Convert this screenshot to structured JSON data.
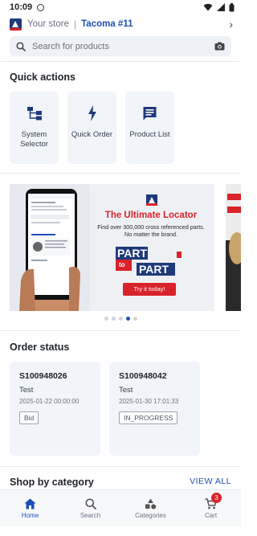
{
  "status_bar": {
    "time": "10:09"
  },
  "store": {
    "label": "Your store",
    "name": "Tacoma #11"
  },
  "search": {
    "placeholder": "Search for products"
  },
  "quick_actions": {
    "title": "Quick actions",
    "items": [
      {
        "label": "System Selector",
        "icon": "hierarchy-icon"
      },
      {
        "label": "Quick Order",
        "icon": "lightning-icon"
      },
      {
        "label": "Product List",
        "icon": "list-chat-icon"
      }
    ]
  },
  "banner": {
    "title": "The Ultimate Locator",
    "subtitle": "Find over 300,000 cross referenced parts. No matter the brand.",
    "logo_text_top": "PART",
    "logo_text_mid": "to",
    "logo_text_bottom": "PART",
    "button": "Try it today!",
    "pager": {
      "count": 5,
      "active": 3
    }
  },
  "order_status": {
    "title": "Order status",
    "orders": [
      {
        "id": "S100948026",
        "name": "Test",
        "date": "2025-01-22 00:00:00",
        "status": "Bid"
      },
      {
        "id": "S100948042",
        "name": "Test",
        "date": "2025-01-30 17:01:33",
        "status": "IN_PROGRESS"
      }
    ]
  },
  "shop_by_category": {
    "title": "Shop by category",
    "view_all": "VIEW ALL"
  },
  "bottom_nav": {
    "items": [
      {
        "label": "Home",
        "active": true
      },
      {
        "label": "Search",
        "active": false
      },
      {
        "label": "Categories",
        "active": false
      },
      {
        "label": "Cart",
        "active": false,
        "badge": "3"
      }
    ]
  },
  "colors": {
    "accent": "#1e4fb8",
    "brand_red": "#d8232a",
    "card_bg": "#f1f4f8"
  }
}
